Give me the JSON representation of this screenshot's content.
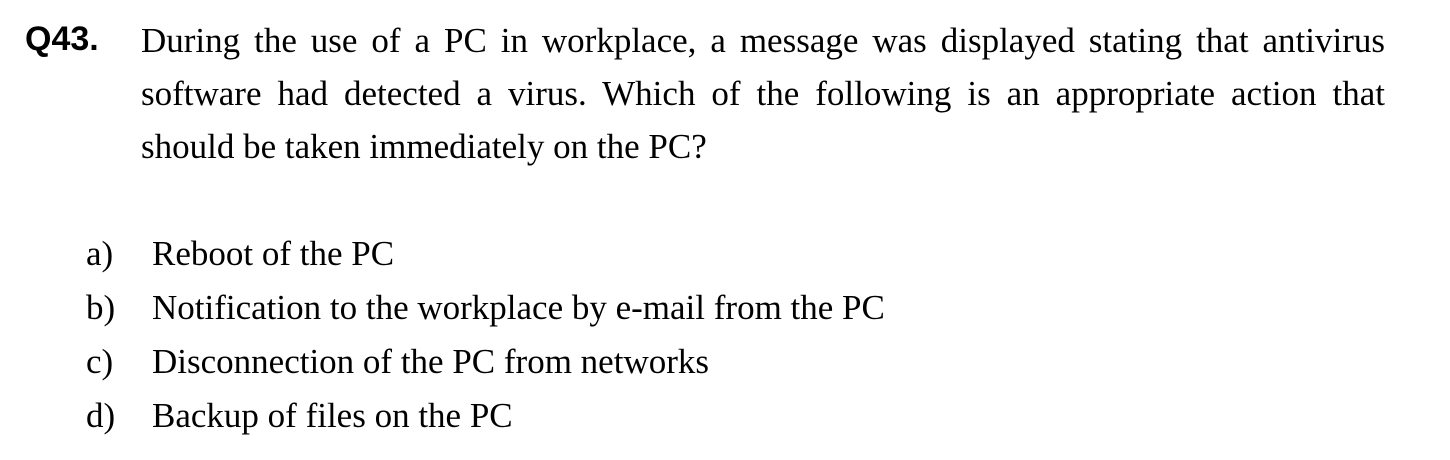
{
  "question": {
    "number": "Q43.",
    "lines": [
      "During the use of a PC in workplace, a message was displayed stating that antivirus",
      "software had detected a virus. Which of the following is an appropriate action that",
      "should be taken immediately on the PC?"
    ]
  },
  "options": [
    {
      "letter": "a)",
      "text": "Reboot of the PC"
    },
    {
      "letter": "b)",
      "text": "Notification to the workplace by e-mail from the PC"
    },
    {
      "letter": "c)",
      "text": "Disconnection of the PC from networks"
    },
    {
      "letter": "d)",
      "text": "Backup of files on the PC"
    }
  ]
}
